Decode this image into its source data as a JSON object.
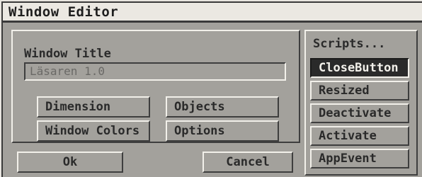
{
  "window": {
    "title": "Window Editor"
  },
  "form": {
    "window_title_label": "Window Title",
    "window_title_value": "Läsaren 1.0"
  },
  "buttons": {
    "dimension": "Dimension",
    "objects": "Objects",
    "window_colors": "Window Colors",
    "options": "Options",
    "ok": "Ok",
    "cancel": "Cancel"
  },
  "scripts": {
    "header": "Scripts...",
    "items": [
      {
        "label": "CloseButton",
        "selected": true
      },
      {
        "label": "Resized",
        "selected": false
      },
      {
        "label": "Deactivate",
        "selected": false
      },
      {
        "label": "Activate",
        "selected": false
      },
      {
        "label": "AppEvent",
        "selected": false
      }
    ]
  }
}
